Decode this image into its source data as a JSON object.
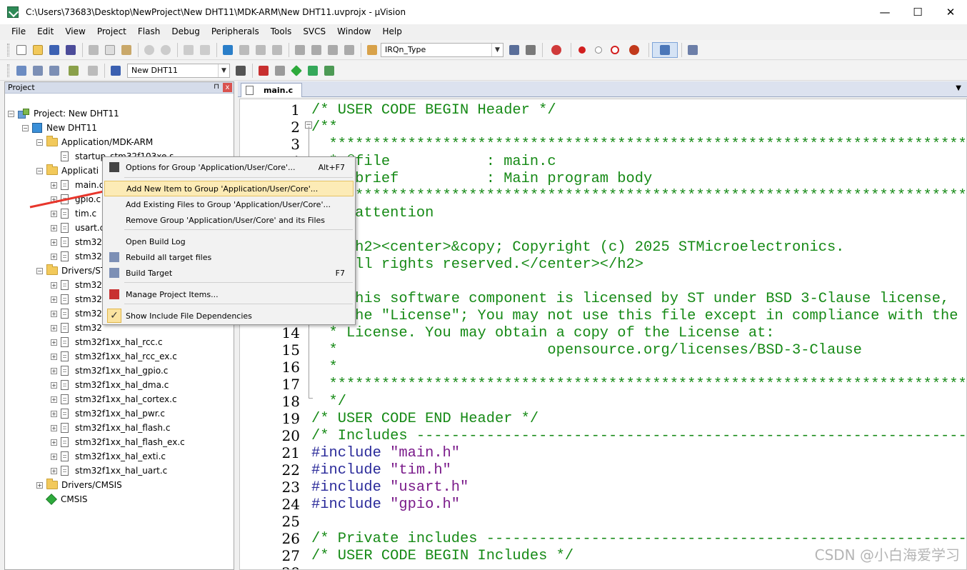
{
  "window": {
    "title": "C:\\Users\\73683\\Desktop\\NewProject\\New DHT11\\MDK-ARM\\New DHT11.uvprojx - µVision",
    "minimize": "—",
    "maximize": "☐",
    "close": "✕"
  },
  "menu": [
    "File",
    "Edit",
    "View",
    "Project",
    "Flash",
    "Debug",
    "Peripherals",
    "Tools",
    "SVCS",
    "Window",
    "Help"
  ],
  "toolbar": {
    "find_combo_value": "IRQn_Type",
    "target_combo_value": "New DHT11"
  },
  "project_panel": {
    "title": "Project",
    "pin": "⊓",
    "close": "x",
    "tree": [
      {
        "label": "Project: New DHT11",
        "level": 0,
        "icon": "project-icon",
        "expander": "−"
      },
      {
        "label": "New DHT11",
        "level": 1,
        "icon": "target-icon",
        "expander": "−"
      },
      {
        "label": "Application/MDK-ARM",
        "level": 2,
        "icon": "folder-icon",
        "expander": "−"
      },
      {
        "label": "startup_stm32f103xe.s",
        "level": 3,
        "icon": "file-icon",
        "expander": ""
      },
      {
        "label": "Applicati",
        "level": 2,
        "icon": "folder-icon",
        "expander": "−"
      },
      {
        "label": "main.c",
        "level": 3,
        "icon": "file-icon",
        "expander": "+"
      },
      {
        "label": "gpio.c",
        "level": 3,
        "icon": "file-icon",
        "expander": "+"
      },
      {
        "label": "tim.c",
        "level": 3,
        "icon": "file-icon",
        "expander": "+"
      },
      {
        "label": "usart.c",
        "level": 3,
        "icon": "file-icon",
        "expander": "+"
      },
      {
        "label": "stm32",
        "level": 3,
        "icon": "file-icon",
        "expander": "+"
      },
      {
        "label": "stm32",
        "level": 3,
        "icon": "file-icon",
        "expander": "+"
      },
      {
        "label": "Drivers/ST",
        "level": 2,
        "icon": "folder-icon",
        "expander": "−"
      },
      {
        "label": "stm32",
        "level": 3,
        "icon": "file-icon",
        "expander": "+"
      },
      {
        "label": "stm32",
        "level": 3,
        "icon": "file-icon",
        "expander": "+"
      },
      {
        "label": "stm32",
        "level": 3,
        "icon": "file-icon",
        "expander": "+"
      },
      {
        "label": "stm32",
        "level": 3,
        "icon": "file-icon",
        "expander": "+"
      },
      {
        "label": "stm32f1xx_hal_rcc.c",
        "level": 3,
        "icon": "file-icon",
        "expander": "+"
      },
      {
        "label": "stm32f1xx_hal_rcc_ex.c",
        "level": 3,
        "icon": "file-icon",
        "expander": "+"
      },
      {
        "label": "stm32f1xx_hal_gpio.c",
        "level": 3,
        "icon": "file-icon",
        "expander": "+"
      },
      {
        "label": "stm32f1xx_hal_dma.c",
        "level": 3,
        "icon": "file-icon",
        "expander": "+"
      },
      {
        "label": "stm32f1xx_hal_cortex.c",
        "level": 3,
        "icon": "file-icon",
        "expander": "+"
      },
      {
        "label": "stm32f1xx_hal_pwr.c",
        "level": 3,
        "icon": "file-icon",
        "expander": "+"
      },
      {
        "label": "stm32f1xx_hal_flash.c",
        "level": 3,
        "icon": "file-icon",
        "expander": "+"
      },
      {
        "label": "stm32f1xx_hal_flash_ex.c",
        "level": 3,
        "icon": "file-icon",
        "expander": "+"
      },
      {
        "label": "stm32f1xx_hal_exti.c",
        "level": 3,
        "icon": "file-icon",
        "expander": "+"
      },
      {
        "label": "stm32f1xx_hal_uart.c",
        "level": 3,
        "icon": "file-icon",
        "expander": "+"
      },
      {
        "label": "Drivers/CMSIS",
        "level": 2,
        "icon": "folder-icon",
        "expander": "+"
      },
      {
        "label": "CMSIS",
        "level": 2,
        "icon": "cmsis-icon",
        "expander": ""
      }
    ]
  },
  "editor": {
    "tab_label": "main.c",
    "lines": [
      {
        "n": "1",
        "t": "/* USER CODE BEGIN Header */",
        "k": "cmt"
      },
      {
        "n": "2",
        "t": "/**",
        "k": "cmt"
      },
      {
        "n": "3",
        "t": "  ******************************************************************************",
        "k": "cmt"
      },
      {
        "n": "4",
        "t": "  * @file           : main.c",
        "k": "cmt"
      },
      {
        "n": "5",
        "t": "  * @brief          : Main program body",
        "k": "cmt"
      },
      {
        "n": "6",
        "t": "  ******************************************************************************",
        "k": "cmt"
      },
      {
        "n": "7",
        "t": "  * @attention",
        "k": "cmt"
      },
      {
        "n": "8",
        "t": "  *",
        "k": "cmt"
      },
      {
        "n": "9",
        "t": "  * <h2><center>&copy; Copyright (c) 2025 STMicroelectronics.",
        "k": "cmt"
      },
      {
        "n": "10",
        "t": "  * All rights reserved.</center></h2>",
        "k": "cmt"
      },
      {
        "n": "11",
        "t": "  *",
        "k": "cmt"
      },
      {
        "n": "12",
        "t": "  * This software component is licensed by ST under BSD 3-Clause license,",
        "k": "cmt"
      },
      {
        "n": "13",
        "t": "  * the \"License\"; You may not use this file except in compliance with the",
        "k": "cmt"
      },
      {
        "n": "14",
        "t": "  * License. You may obtain a copy of the License at:",
        "k": "cmt"
      },
      {
        "n": "15",
        "t": "  *                        opensource.org/licenses/BSD-3-Clause",
        "k": "cmt"
      },
      {
        "n": "16",
        "t": "  *",
        "k": "cmt"
      },
      {
        "n": "17",
        "t": "  ******************************************************************************",
        "k": "cmt"
      },
      {
        "n": "18",
        "t": "  */",
        "k": "cmt"
      },
      {
        "n": "19",
        "t": "/* USER CODE END Header */",
        "k": "cmt"
      },
      {
        "n": "20",
        "t": "/* Includes ------------------------------------------------------------------",
        "k": "cmt"
      },
      {
        "n": "21",
        "t": "#include \"main.h\"",
        "k": "inc"
      },
      {
        "n": "22",
        "t": "#include \"tim.h\"",
        "k": "inc"
      },
      {
        "n": "23",
        "t": "#include \"usart.h\"",
        "k": "inc"
      },
      {
        "n": "24",
        "t": "#include \"gpio.h\"",
        "k": "inc"
      },
      {
        "n": "25",
        "t": "",
        "k": "cmt"
      },
      {
        "n": "26",
        "t": "/* Private includes ----------------------------------------------------------",
        "k": "cmt"
      },
      {
        "n": "27",
        "t": "/* USER CODE BEGIN Includes */",
        "k": "cmt"
      },
      {
        "n": "28",
        "t": "",
        "k": "cmt"
      }
    ]
  },
  "context_menu": {
    "items": [
      {
        "label": "Options for Group 'Application/User/Core'...",
        "shortcut": "Alt+F7",
        "icon": "options-icon"
      },
      {
        "label": "Add New  Item to Group 'Application/User/Core'...",
        "shortcut": "",
        "icon": "",
        "hover": true
      },
      {
        "label": "Add Existing Files to Group 'Application/User/Core'...",
        "shortcut": "",
        "icon": ""
      },
      {
        "label": "Remove Group 'Application/User/Core' and its Files",
        "shortcut": "",
        "icon": ""
      },
      {
        "label": "Open Build Log",
        "shortcut": "",
        "icon": ""
      },
      {
        "label": "Rebuild all target files",
        "shortcut": "",
        "icon": "rebuild-icon"
      },
      {
        "label": "Build Target",
        "shortcut": "F7",
        "icon": "build-icon"
      },
      {
        "label": "Manage Project Items...",
        "shortcut": "",
        "icon": "manage-items-icon"
      },
      {
        "label": "Show Include File Dependencies",
        "shortcut": "",
        "icon": "checkmark-icon"
      }
    ]
  },
  "watermark": "CSDN @小白海爱学习",
  "colors": {
    "comment": "#168a16",
    "preprocessor": "#2a2a9a",
    "string": "#7a1a8a",
    "menu_hover": "#fcebb6",
    "annotation_arrow": "#e8362c"
  }
}
